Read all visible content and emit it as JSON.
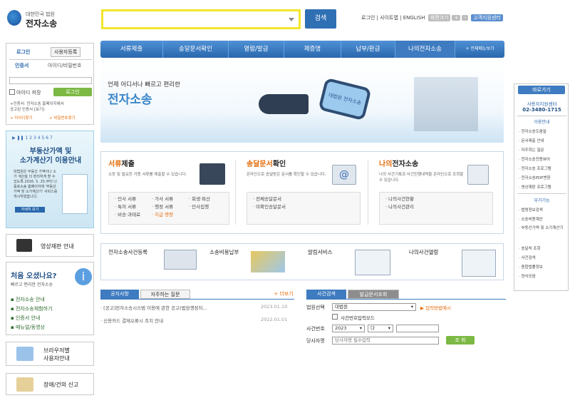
{
  "logo": {
    "line1": "대한민국 법원",
    "line2": "전자소송"
  },
  "search": {
    "placeholder": "",
    "button": "검색"
  },
  "top_links": {
    "login": "로그인",
    "sitemap": "사이트맵",
    "english": "ENGLISH",
    "zoom": "화면크기",
    "zoom_plus": "+",
    "zoom_minus": "-",
    "remote": "고객지원센터"
  },
  "gnb": [
    "서류제출",
    "송달문서확인",
    "열람/발급",
    "제증명",
    "납부/환급",
    "나의전자소송",
    "+ 전체메뉴보기"
  ],
  "login": {
    "tab_login": "로그인",
    "tab_signup": "사용자등록",
    "tab_cert": "인증서",
    "tab_id": "아이디/비밀번호",
    "save_id": "아이디 저장",
    "login_btn": "로그인",
    "note1": "+인증서: 전자소송 홈페이지에서",
    "note2": "공고된 인증서 [보기]",
    "find_id": "+ 아이디찾기",
    "find_pw": "+ 비밀번호찾기"
  },
  "banner": {
    "title1": "부동산가액 및",
    "title2": "소가계산기 이용안내",
    "desc": "대법원은 부동산 가액이나 소가 계산을 더 편리하게 할 수 있도록 2016. 5. 25.부터 나홀로소송 홈페이지에 '부동산가액 및 소가계산기' 서비스를 개시하였습니다.",
    "detail": "자세히 보기",
    "pages": [
      "1",
      "2",
      "3",
      "4",
      "5",
      "6",
      "7"
    ]
  },
  "left_links": {
    "video": "영상재판 안내",
    "first_title": "처음 오셨나요?",
    "first_sub": "빠르고 편리한 전자소송",
    "first_items": [
      "전자소송 안내",
      "전자소송체험하기",
      "인증서 안내",
      "매뉴얼/동영상"
    ],
    "browser1": "브라우저별",
    "browser2": "사용자안내",
    "report": "장애/건의 신고"
  },
  "hero": {
    "sub": "언제 어디서나 빠르고 편리한",
    "big": "전자소송",
    "device_text": "대법원 전자소송"
  },
  "services": [
    {
      "accent": "서류",
      "rest": "제출",
      "desc": "소장 및 필요한 각종 서류를 제출할 수 있습니다.",
      "items": [
        [
          "· 민사 서류",
          "· 가사 서류",
          "· 회생·파산"
        ],
        [
          "· 특허 서류",
          "· 행정 서류",
          "· 민사집행"
        ],
        [
          "· 비송·과태료",
          "· 지급 명령",
          ""
        ]
      ]
    },
    {
      "accent": "송달문서",
      "rest": "확인",
      "desc": "온라인으로 송달받은 문서를 확인할 수 있습니다.",
      "items": [
        [
          "· 전체송달문서"
        ],
        [
          "· 미확인송달문서"
        ]
      ]
    },
    {
      "accent": "나의",
      "rest": "전자소송",
      "desc": "나의 사건기록과 사건진행내역을 온라인으로 조회할 수 있습니다.",
      "items": [
        [
          "· 나의사건현황"
        ],
        [
          "· 나의사건관리"
        ]
      ]
    }
  ],
  "quick": [
    "전자소송사건등록",
    "소송비용납부",
    "알림서비스",
    "나의사건열람"
  ],
  "notice": {
    "tab1": "공지사항",
    "tab2": "자주하는 질문",
    "more": "+ 더보기",
    "rows": [
      {
        "title": "· [공고]전자소송시스템 이용에 관한 공고(법원행정처...",
        "date": "2023.01.10"
      },
      {
        "title": "· 신용카드 결제오류시 조치 안내",
        "date": "2022.01.01"
      }
    ]
  },
  "case": {
    "tab1": "사건검색",
    "tab2": "발급문서조회",
    "court_label": "법원선택",
    "court_value": "대법원",
    "method": "▶ 입력방법예시",
    "code_check": "사건번호입력모드",
    "no_label": "사건번호",
    "year": "2023",
    "type": "다",
    "party_label": "당사자명",
    "party_placeholder": "당사자명 필수입력",
    "search_btn": "조 회"
  },
  "right": {
    "head": "바로가기",
    "center": "사용자지원센터",
    "phone": "02-3480-1715",
    "cat1": "이용안내",
    "items1": [
      "전자소송도움말",
      "문서제출 안내",
      "자주하는 질문",
      "전자소송전용뷰어",
      "전자소송 프로그램",
      "전자소송PDF변환",
      "영상재판 프로그램"
    ],
    "cat2": "부가기능",
    "items2": [
      "법령정보검색",
      "소송비용계산",
      "부동산가액 및 소가계산기",
      "송달처 조회",
      "사건검색",
      "종합법률정보",
      "양식모음"
    ]
  }
}
